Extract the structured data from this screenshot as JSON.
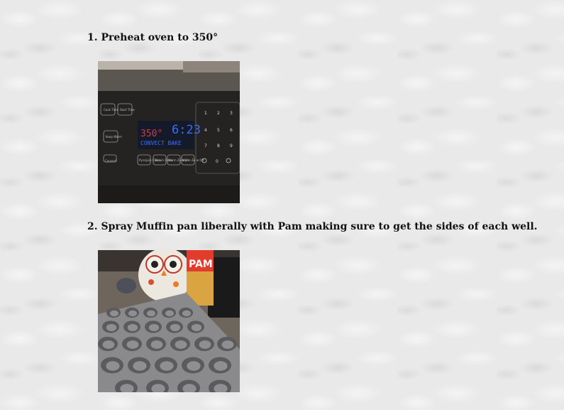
{
  "steps": [
    {
      "text": "1. Preheat oven to 350°",
      "photo": {
        "keypad_labels": [
          "Cook Time",
          "Start Time",
          "Keep Warm",
          "Convect",
          "Pyrolysis Clean",
          "Steam Clean",
          "Warm Zone On",
          "Warm Zone Off"
        ],
        "display_temp": "350°",
        "display_clock": "6:23",
        "display_mode": "CONVECT BAKE",
        "digits": [
          "1",
          "2",
          "3",
          "4",
          "5",
          "6",
          "7",
          "8",
          "9",
          "0"
        ]
      }
    },
    {
      "text": "2. Spray Muffin pan liberally with Pam making sure to get the sides of each well.",
      "photo": {
        "can_brand": "PAM"
      }
    }
  ]
}
